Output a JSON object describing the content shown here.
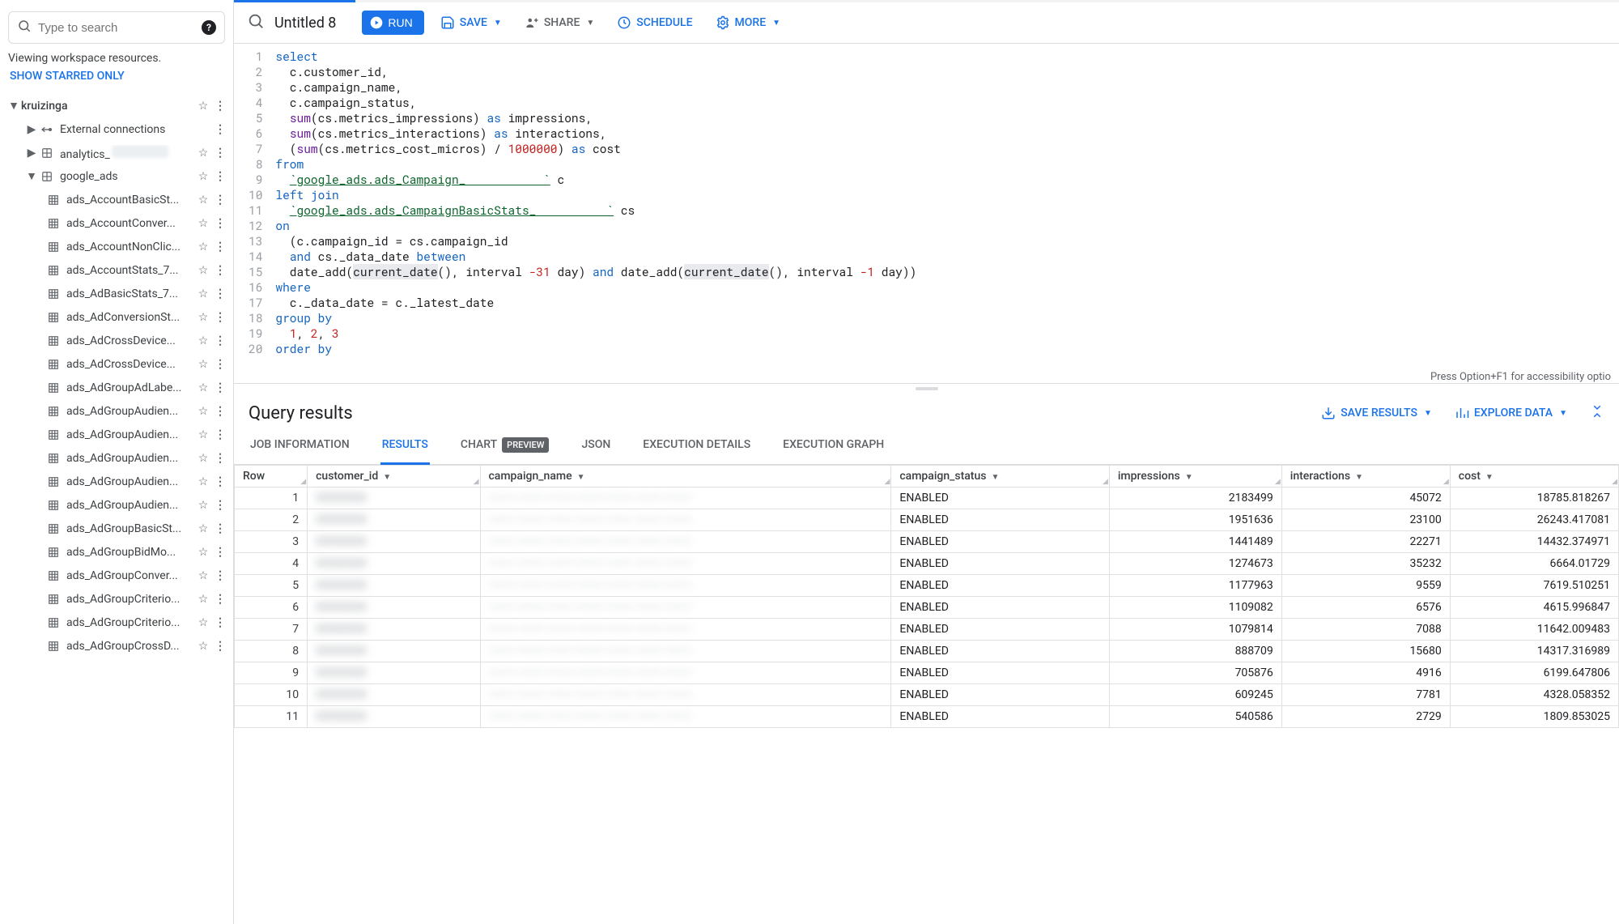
{
  "sidebar": {
    "search_placeholder": "Type to search",
    "viewing_label": "Viewing workspace resources.",
    "show_starred": "SHOW STARRED ONLY",
    "project": "kruizinga",
    "nodes": {
      "external": "External connections",
      "analytics": "analytics_",
      "google_ads": "google_ads"
    },
    "tables": [
      "ads_AccountBasicSt...",
      "ads_AccountConver...",
      "ads_AccountNonClic...",
      "ads_AccountStats_7...",
      "ads_AdBasicStats_7...",
      "ads_AdConversionSt...",
      "ads_AdCrossDevice...",
      "ads_AdCrossDevice...",
      "ads_AdGroupAdLabe...",
      "ads_AdGroupAudien...",
      "ads_AdGroupAudien...",
      "ads_AdGroupAudien...",
      "ads_AdGroupAudien...",
      "ads_AdGroupAudien...",
      "ads_AdGroupBasicSt...",
      "ads_AdGroupBidMo...",
      "ads_AdGroupConver...",
      "ads_AdGroupCriterio...",
      "ads_AdGroupCriterio...",
      "ads_AdGroupCrossD..."
    ]
  },
  "toolbar": {
    "title": "Untitled 8",
    "run": "RUN",
    "save": "SAVE",
    "share": "SHARE",
    "schedule": "SCHEDULE",
    "more": "MORE"
  },
  "editor": {
    "lines": [
      {
        "n": 1,
        "t": [
          [
            "kw",
            "select"
          ]
        ]
      },
      {
        "n": 2,
        "t": [
          [
            "pl",
            "  c.customer_id,"
          ]
        ]
      },
      {
        "n": 3,
        "t": [
          [
            "pl",
            "  c.campaign_name,"
          ]
        ]
      },
      {
        "n": 4,
        "t": [
          [
            "pl",
            "  c.campaign_status,"
          ]
        ]
      },
      {
        "n": 5,
        "t": [
          [
            "pl",
            "  "
          ],
          [
            "fn",
            "sum"
          ],
          [
            "pl",
            "(cs.metrics_impressions) "
          ],
          [
            "kw",
            "as"
          ],
          [
            "pl",
            " impressions,"
          ]
        ]
      },
      {
        "n": 6,
        "t": [
          [
            "pl",
            "  "
          ],
          [
            "fn",
            "sum"
          ],
          [
            "pl",
            "(cs.metrics_interactions) "
          ],
          [
            "kw",
            "as"
          ],
          [
            "pl",
            " interactions,"
          ]
        ]
      },
      {
        "n": 7,
        "t": [
          [
            "pl",
            "  ("
          ],
          [
            "fn",
            "sum"
          ],
          [
            "pl",
            "(cs.metrics_cost_micros) / "
          ],
          [
            "num",
            "1000000"
          ],
          [
            "pl",
            ") "
          ],
          [
            "kw",
            "as"
          ],
          [
            "pl",
            " cost"
          ]
        ]
      },
      {
        "n": 8,
        "t": [
          [
            "kw",
            "from"
          ]
        ]
      },
      {
        "n": 9,
        "t": [
          [
            "pl",
            "  "
          ],
          [
            "str",
            "`google_ads.ads_Campaign_           `"
          ],
          [
            "pl",
            " c"
          ]
        ]
      },
      {
        "n": 10,
        "t": [
          [
            "kw",
            "left join"
          ]
        ]
      },
      {
        "n": 11,
        "t": [
          [
            "pl",
            "  "
          ],
          [
            "str",
            "`google_ads.ads_CampaignBasicStats_          `"
          ],
          [
            "pl",
            " cs"
          ]
        ]
      },
      {
        "n": 12,
        "t": [
          [
            "kw",
            "on"
          ]
        ]
      },
      {
        "n": 13,
        "t": [
          [
            "pl",
            "  (c.campaign_id = cs.campaign_id"
          ]
        ]
      },
      {
        "n": 14,
        "t": [
          [
            "pl",
            "  "
          ],
          [
            "kw",
            "and"
          ],
          [
            "pl",
            " cs._data_date "
          ],
          [
            "kw",
            "between"
          ]
        ]
      },
      {
        "n": 15,
        "t": [
          [
            "pl",
            "  date_add("
          ],
          [
            "hl",
            "current_date"
          ],
          [
            "pl",
            "(), interval "
          ],
          [
            "num",
            "-31"
          ],
          [
            "pl",
            " day) "
          ],
          [
            "kw",
            "and"
          ],
          [
            "pl",
            " date_add("
          ],
          [
            "hl",
            "current_date"
          ],
          [
            "pl",
            "(), interval "
          ],
          [
            "num",
            "-1"
          ],
          [
            "pl",
            " day))"
          ]
        ]
      },
      {
        "n": 16,
        "t": [
          [
            "kw",
            "where"
          ]
        ]
      },
      {
        "n": 17,
        "t": [
          [
            "pl",
            "  c._data_date = c._latest_date"
          ]
        ]
      },
      {
        "n": 18,
        "t": [
          [
            "kw",
            "group by"
          ]
        ]
      },
      {
        "n": 19,
        "t": [
          [
            "pl",
            "  "
          ],
          [
            "num",
            "1"
          ],
          [
            "pl",
            ", "
          ],
          [
            "num",
            "2"
          ],
          [
            "pl",
            ", "
          ],
          [
            "num",
            "3"
          ]
        ]
      },
      {
        "n": 20,
        "t": [
          [
            "kw",
            "order by"
          ]
        ]
      }
    ],
    "hint": "Press Option+F1 for accessibility optio"
  },
  "results": {
    "title": "Query results",
    "save_results": "SAVE RESULTS",
    "explore_data": "EXPLORE DATA",
    "tabs": {
      "job": "JOB INFORMATION",
      "results": "RESULTS",
      "chart": "CHART",
      "preview": "PREVIEW",
      "json": "JSON",
      "exec_details": "EXECUTION DETAILS",
      "exec_graph": "EXECUTION GRAPH"
    },
    "columns": [
      "Row",
      "customer_id",
      "campaign_name",
      "campaign_status",
      "impressions",
      "interactions",
      "cost"
    ],
    "rows": [
      {
        "row": 1,
        "status": "ENABLED",
        "impressions": "2183499",
        "interactions": "45072",
        "cost": "18785.818267"
      },
      {
        "row": 2,
        "status": "ENABLED",
        "impressions": "1951636",
        "interactions": "23100",
        "cost": "26243.417081"
      },
      {
        "row": 3,
        "status": "ENABLED",
        "impressions": "1441489",
        "interactions": "22271",
        "cost": "14432.374971"
      },
      {
        "row": 4,
        "status": "ENABLED",
        "impressions": "1274673",
        "interactions": "35232",
        "cost": "6664.01729"
      },
      {
        "row": 5,
        "status": "ENABLED",
        "impressions": "1177963",
        "interactions": "9559",
        "cost": "7619.510251"
      },
      {
        "row": 6,
        "status": "ENABLED",
        "impressions": "1109082",
        "interactions": "6576",
        "cost": "4615.996847"
      },
      {
        "row": 7,
        "status": "ENABLED",
        "impressions": "1079814",
        "interactions": "7088",
        "cost": "11642.009483"
      },
      {
        "row": 8,
        "status": "ENABLED",
        "impressions": "888709",
        "interactions": "15680",
        "cost": "14317.316989"
      },
      {
        "row": 9,
        "status": "ENABLED",
        "impressions": "705876",
        "interactions": "4916",
        "cost": "6199.647806"
      },
      {
        "row": 10,
        "status": "ENABLED",
        "impressions": "609245",
        "interactions": "7781",
        "cost": "4328.058352"
      },
      {
        "row": 11,
        "status": "ENABLED",
        "impressions": "540586",
        "interactions": "2729",
        "cost": "1809.853025"
      }
    ]
  }
}
